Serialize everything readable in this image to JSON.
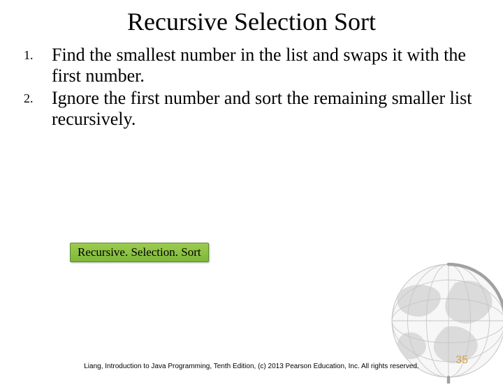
{
  "title": "Recursive Selection Sort",
  "items": [
    {
      "marker": "1.",
      "text": "Find the smallest number in the list and swaps it with the first number."
    },
    {
      "marker": "2.",
      "text": "Ignore the first number and sort the remaining smaller list recursively."
    }
  ],
  "code_button": "Recursive. Selection. Sort",
  "footer": "Liang, Introduction to Java Programming, Tenth Edition, (c) 2013 Pearson Education, Inc. All rights reserved.",
  "page_number": "35"
}
